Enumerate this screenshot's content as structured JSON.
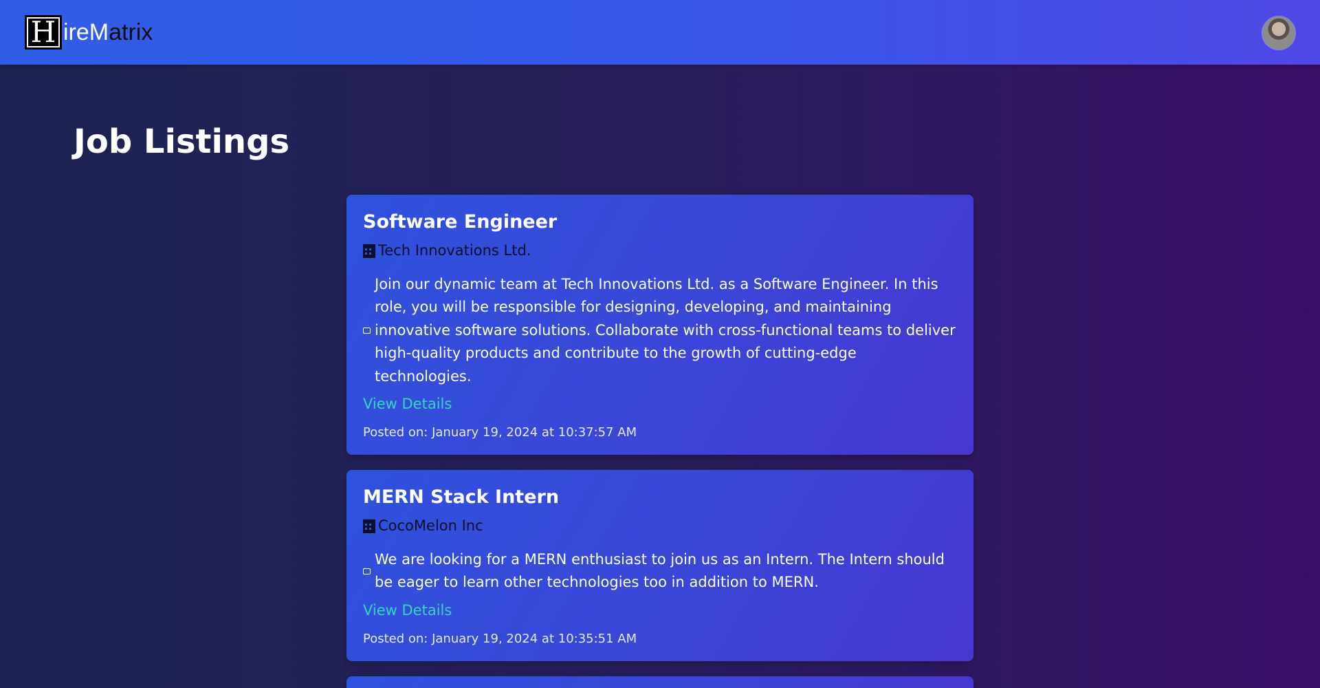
{
  "app": {
    "logo_initial": "H",
    "logo_rest_light": "ire",
    "logo_rest_accent": "M",
    "logo_rest_dark": "atrix"
  },
  "page": {
    "title": "Job Listings"
  },
  "jobs": [
    {
      "title": "Software Engineer",
      "company": "Tech Innovations Ltd.",
      "description": "Join our dynamic team at Tech Innovations Ltd. as a Software Engineer. In this role, you will be responsible for designing, developing, and maintaining innovative software solutions. Collaborate with cross-functional teams to deliver high-quality products and contribute to the growth of cutting-edge technologies.",
      "link_label": "View Details",
      "posted": "Posted on: January 19, 2024 at 10:37:57 AM"
    },
    {
      "title": "MERN Stack Intern",
      "company": "CocoMelon Inc",
      "description": "We are looking for a MERN enthusiast to join us as an Intern. The Intern should be eager to learn other technologies too in addition to MERN.",
      "link_label": "View Details",
      "posted": "Posted on: January 19, 2024 at 10:35:51 AM"
    }
  ],
  "icons": {
    "company": "building-icon",
    "description": "speech-bubble-icon",
    "avatar": "user-avatar"
  },
  "colors": {
    "navbar": "#3658e8",
    "card": "#3b46d6",
    "link": "#34d6c0",
    "background_left": "#1c2352",
    "background_right": "#3b0e68"
  }
}
